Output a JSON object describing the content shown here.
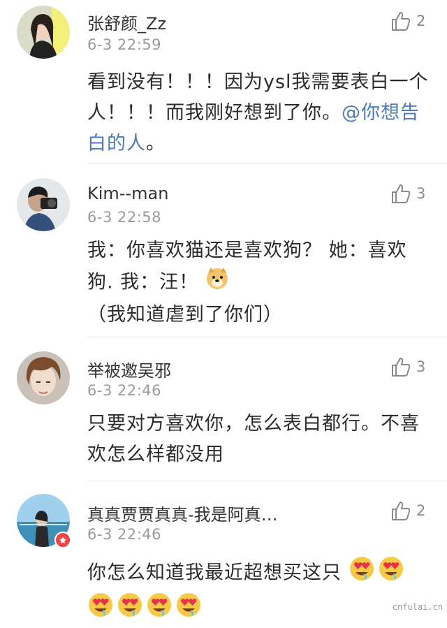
{
  "comments": [
    {
      "username": "张舒颜_Zz",
      "time": "6-3 22:59",
      "likes": "2",
      "text_before": "看到没有！！！因为ysl我需要表白一个人！！！而我刚好想到了你。",
      "mention": "@你想告白的人",
      "text_after": "。"
    },
    {
      "username": "Kim--man",
      "time": "6-3 22:58",
      "likes": "3",
      "text_before": "我：你喜欢猫还是喜欢狗？ 她：喜欢狗. 我：汪！",
      "emoji": "doge-emoji",
      "text_after": "（我知道虐到了你们）"
    },
    {
      "username": "举被邀吴邪",
      "time": "6-3 22:46",
      "likes": "3",
      "text": "只要对方喜欢你，怎么表白都行。不喜欢怎么样都没用"
    },
    {
      "username": "真真贾贾真真-我是阿真…",
      "time": "6-3 22:46",
      "likes": "2",
      "text": "你怎么知道我最近超想买这只",
      "emoji": "heart-eyes-emoji"
    }
  ],
  "watermark": "cnfulai.cn",
  "colors": {
    "mention": "#4a7bb7",
    "divider": "#e6e6e6",
    "badge": "#ee4444"
  }
}
